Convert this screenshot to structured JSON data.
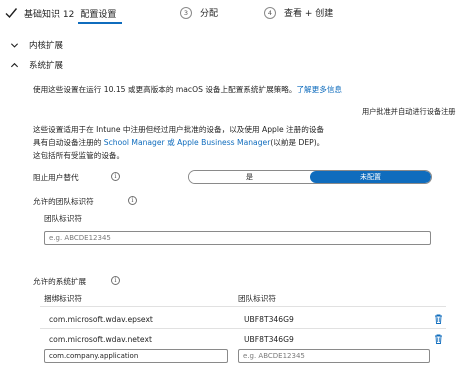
{
  "wizard": {
    "step1_title": "基础知识 12",
    "step1_sub": "配置设置",
    "step2_num": "3",
    "step2_label": "分配",
    "step3_num": "4",
    "step3_label": "查看 + 创建"
  },
  "sections": {
    "kernel_ext": "内核扩展",
    "system_ext": "系统扩展"
  },
  "description": {
    "line1": "使用这些设置在运行 10.15 或更高版本的 macOS 设备上配置系统扩展策略。",
    "learn_more": "了解更多信息",
    "right_note": "用户批准并自动进行设备注册",
    "para_line1": "这些设置适用于在 Intune 中注册但经过用户批准的设备，以及使用 Apple 注册的设备",
    "para_line2_prefix": "具有自动设备注册的 ",
    "para_line2_link": "School Manager 或 Apple Business Manager",
    "para_line2_suffix": "(以前是 DEP)。",
    "para_line3": "这包括所有受监管的设备。"
  },
  "block_override": {
    "label": "阻止用户替代",
    "option_yes": "是",
    "option_not_configured": "未配置",
    "selected": "未配置"
  },
  "allowed_teams": {
    "label": "允许的团队标识符",
    "column_header": "团队标识符",
    "placeholder": "e.g. ABCDE12345"
  },
  "allowed_system_ext": {
    "label": "允许的系统扩展",
    "col_bundle": "捆绑标识符",
    "col_team": "团队标识符",
    "rows": [
      {
        "bundle": "com.microsoft.wdav.epsext",
        "team": "UBF8T346G9"
      },
      {
        "bundle": "com.microsoft.wdav.netext",
        "team": "UBF8T346G9"
      }
    ],
    "new_bundle_placeholder": "com.company.application",
    "new_team_placeholder": "e.g. ABCDE12345"
  },
  "icons": {
    "check": "check-icon",
    "chevron_right": "chevron-right-icon",
    "chevron_down": "chevron-down-icon",
    "info": "info-icon",
    "trash": "trash-icon"
  },
  "colors": {
    "accent": "#0f6cbd",
    "text": "#1f1f1f",
    "muted": "#7a7a7a"
  }
}
